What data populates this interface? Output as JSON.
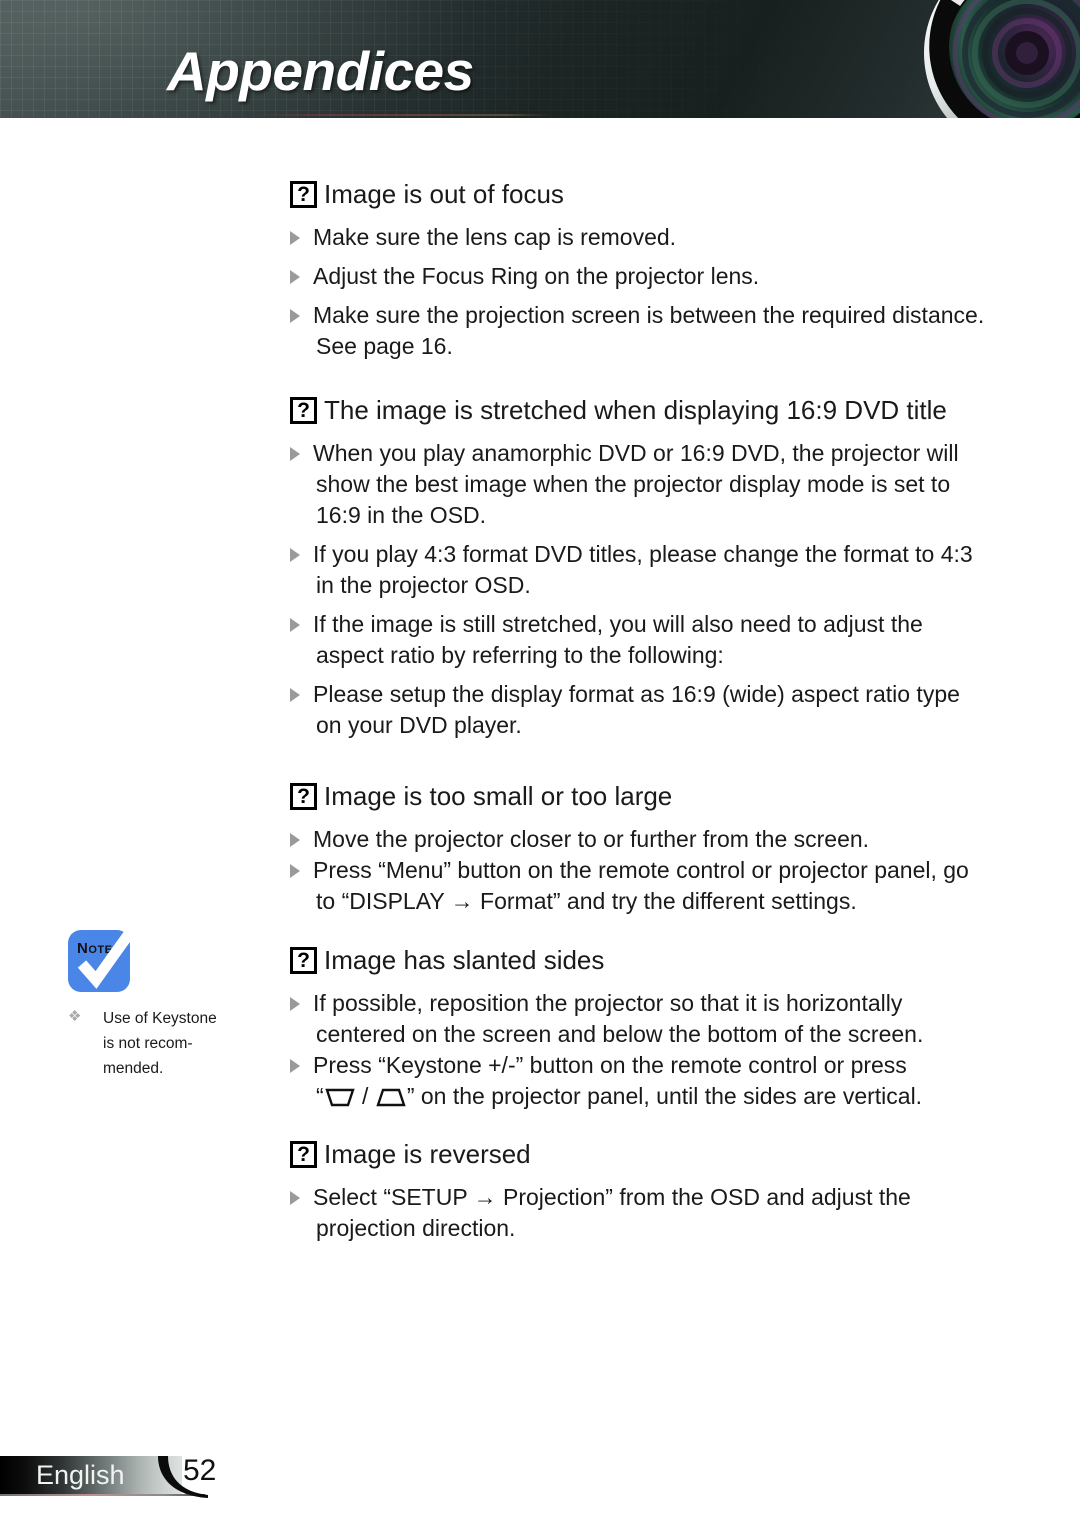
{
  "header": {
    "title": "Appendices",
    "lens_icon": "camera-lens-graphic"
  },
  "sections": [
    {
      "icon": "question-mark-icon",
      "heading": "Image is out of focus",
      "bullets": [
        {
          "line1": "Make sure the lens cap is removed."
        },
        {
          "line1": "Adjust the Focus Ring on the projector lens."
        },
        {
          "line1": "Make sure the projection screen is between the required distance.",
          "line2": "See page 16."
        }
      ]
    },
    {
      "icon": "question-mark-icon",
      "heading": "The image is stretched when displaying 16:9 DVD title",
      "bullets": [
        {
          "line1": "When you play anamorphic DVD or 16:9 DVD, the projector will",
          "line2": "show the best image when the projector display mode is set to",
          "line3": "16:9 in the OSD."
        },
        {
          "line1": "If you play 4:3 format DVD titles, please change the format to 4:3",
          "line2": "in the projector OSD."
        },
        {
          "line1": "If the image is still stretched, you will also need to adjust the",
          "line2": "aspect ratio by referring to the following:"
        },
        {
          "line1": "Please setup the display format as 16:9 (wide) aspect ratio type",
          "line2": "on your DVD player."
        }
      ]
    },
    {
      "icon": "question-mark-icon",
      "heading": "Image is too small or too large",
      "bullets": [
        {
          "line1": "Move the projector closer to or further from the screen."
        },
        {
          "line1": "Press “Menu” button on the remote control or projector panel, go",
          "line2": "to “DISPLAY → Format” and try the different settings."
        }
      ]
    },
    {
      "icon": "question-mark-icon",
      "heading": "Image has slanted sides",
      "bullets": [
        {
          "line1": "If possible, reposition the projector so that it is horizontally",
          "line2": "centered on the screen and below the bottom of the screen."
        },
        {
          "line1": "Press “Keystone +/-” button on the remote control or press",
          "line2_prefix": "“",
          "line2_suffix": "” on the projector panel, until the sides are vertical.",
          "line2_icons": [
            "keystone-trapezoid-down-icon",
            "keystone-trapezoid-up-icon"
          ],
          "line2_separator": " / "
        }
      ]
    },
    {
      "icon": "question-mark-icon",
      "heading": "Image is reversed",
      "bullets": [
        {
          "line1": "Select “SETUP → Projection” from the OSD and adjust the",
          "line2": "projection direction."
        }
      ]
    }
  ],
  "note": {
    "badge_label": "Note",
    "badge_icon": "note-checkmark-icon",
    "bullet_icon": "diamond-bullet-icon",
    "text_line1": "Use of Keystone",
    "text_line2": "is not recom-",
    "text_line3": "mended."
  },
  "footer": {
    "language": "English",
    "page_number": "52"
  },
  "colors": {
    "note_blue": "#4a86e8",
    "header_dark": "#1c2424",
    "bullet_gray": "#9a9a9a"
  }
}
